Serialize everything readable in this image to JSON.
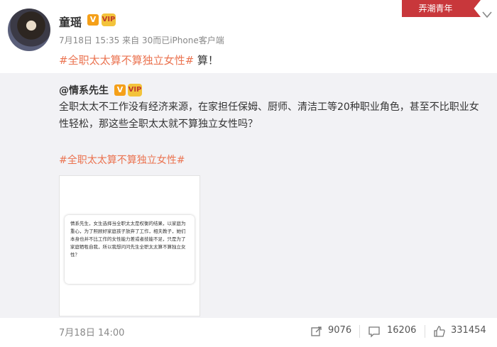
{
  "post": {
    "username": "童瑶",
    "verified_badge": "V",
    "vip_badge": "VIP",
    "meta": "7月18日 15:35 来自 30而已iPhone客户端",
    "hashtag": "#全职太太算不算独立女性#",
    "text_suffix": " 算！"
  },
  "ribbon": {
    "label": "弄潮青年",
    "color": "#c8373b"
  },
  "repost": {
    "username": "@情系先生",
    "text": "全职太太不工作没有经济来源，在家担任保姆、厨师、清洁工等20种职业角色，甚至不比职业女性轻松，那这些全职太太就不算独立女性吗？",
    "hashtag": "#全职太太算不算独立女性#",
    "image_text": "情系先生，女生选择当全职太太是权衡的结果，以家庭为重心，为了照顾好家庭孩子放弃了工作，相夫教子，她们本身也并不比工作的女性能力差或者技能不足，只是为了家庭牺牲自我，所以我想问问先生全职太太算不算独立女性？",
    "time": "7月18日 14:00",
    "actions": {
      "repost_count": "9076",
      "comment_count": "16206",
      "like_count": "331454"
    }
  },
  "colors": {
    "hashtag": "#eb7350",
    "repost_bg": "#f2f2f5",
    "badge": "#f5a019"
  }
}
